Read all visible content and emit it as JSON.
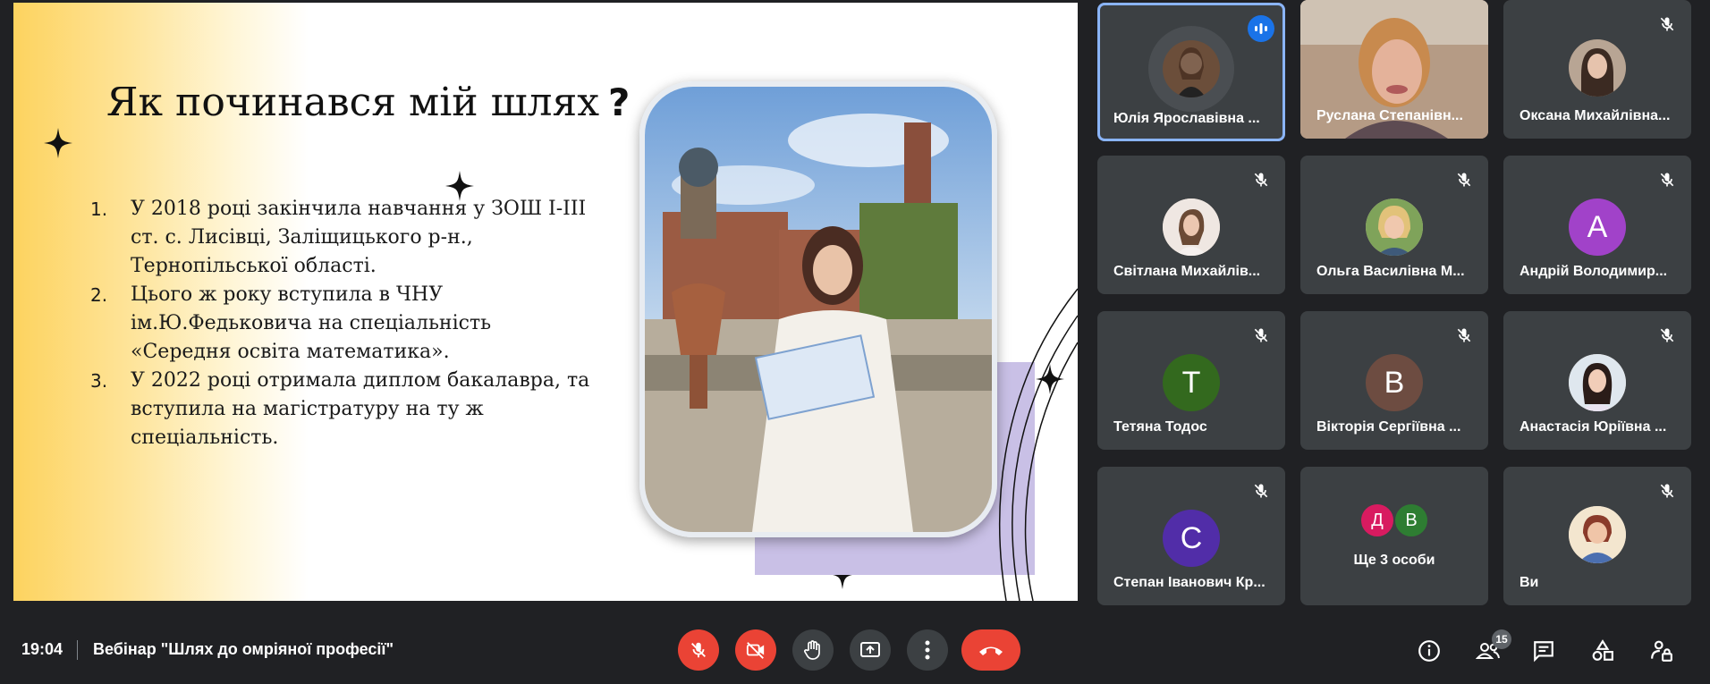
{
  "slide": {
    "title": "Як починався мій шлях",
    "title_mark": "?",
    "items": [
      {
        "num": "1.",
        "text": "У 2018 році закінчила навчання у ЗОШ І-ІІІ ст. с. Лисівці, Заліщицького р-н., Тернопільської області."
      },
      {
        "num": "2.",
        "text": "Цього ж року вступила в ЧНУ ім.Ю.Федьковича на спеціальність «Середня освіта математика»."
      },
      {
        "num": "3.",
        "text": "У 2022 році отримала диплом бакалавра, та вступила на магістратуру на ту ж спеціальність."
      }
    ]
  },
  "participants": [
    {
      "name": "Юлія Ярославівна ...",
      "type": "photo",
      "speaking": true
    },
    {
      "name": "Руслана Степанівн...",
      "type": "video"
    },
    {
      "name": "Оксана Михайлівна...",
      "type": "photo",
      "muted": true
    },
    {
      "name": "Світлана Михайлів...",
      "type": "photo",
      "muted": true
    },
    {
      "name": "Ольга Василівна М...",
      "type": "photo",
      "muted": true
    },
    {
      "name": "Андрій Володимир...",
      "type": "letter",
      "letter": "А",
      "color": "#a142c9",
      "muted": true
    },
    {
      "name": "Тетяна Тодос",
      "type": "letter",
      "letter": "Т",
      "color": "#33691e",
      "muted": true
    },
    {
      "name": "Вікторія Сергіївна ...",
      "type": "letter",
      "letter": "В",
      "color": "#6d4c41",
      "muted": true
    },
    {
      "name": "Анастасія Юріївна ...",
      "type": "photo",
      "muted": true
    },
    {
      "name": "Степан Іванович Кр...",
      "type": "letter",
      "letter": "С",
      "color": "#512da8",
      "muted": true
    },
    {
      "name": "Ще 3 особи",
      "type": "group",
      "letters": [
        "Д",
        "В"
      ],
      "colors": [
        "#d81b60",
        "#2e7d32"
      ]
    },
    {
      "name": "Ви",
      "type": "photo",
      "muted": true
    }
  ],
  "bottom": {
    "time": "19:04",
    "meeting_title": "Вебінар \"Шлях до омріяної професії\"",
    "people_count": "15"
  },
  "colors": {
    "accent": "#1a73e8",
    "danger": "#ea4335",
    "tile": "#3c4043",
    "bg": "#202124"
  }
}
